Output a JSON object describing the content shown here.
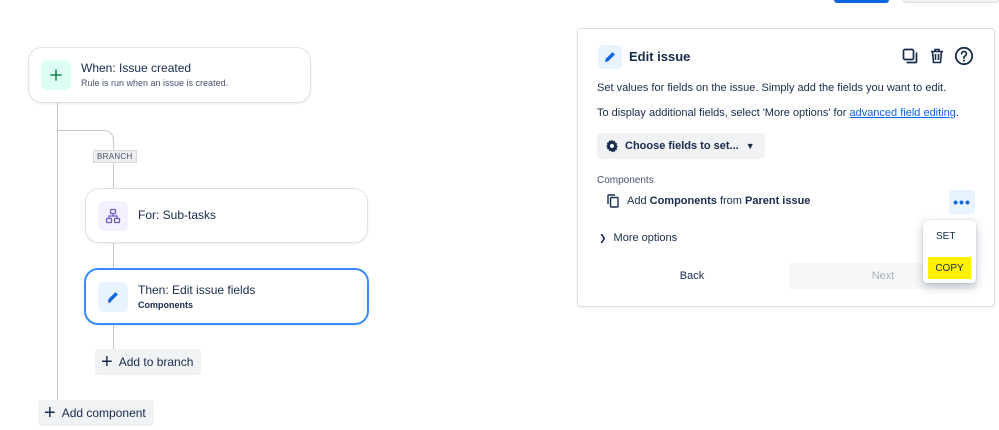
{
  "workflow": {
    "trigger": {
      "title": "When: Issue created",
      "subtitle": "Rule is run when an issue is created."
    },
    "branch_tag": "BRANCH",
    "branch": {
      "title": "For: Sub-tasks"
    },
    "action": {
      "title": "Then: Edit issue fields",
      "subtitle": "Components"
    },
    "add_to_branch": "Add to branch",
    "add_component": "Add component"
  },
  "panel": {
    "title": "Edit issue",
    "description": "Set values for fields on the issue. Simply add the fields you want to edit.",
    "additional_prefix": "To display additional fields, select 'More options' for ",
    "additional_link": "advanced field editing",
    "additional_suffix": ".",
    "choose_fields": "Choose fields to set...",
    "components_label": "Components",
    "component_row": {
      "verb": "Add",
      "field": "Components",
      "from": "from",
      "source": "Parent issue"
    },
    "more_options": "More options",
    "back": "Back",
    "next": "Next",
    "more_menu_dots": "•••"
  },
  "dropdown": {
    "items": [
      "SET",
      "COPY"
    ],
    "highlighted": "COPY"
  },
  "colors": {
    "accent": "#0c66e4",
    "trigger_icon_bg": "#dcfff1",
    "branch_icon_bg": "#f3f0ff",
    "highlight": "#fff200"
  }
}
